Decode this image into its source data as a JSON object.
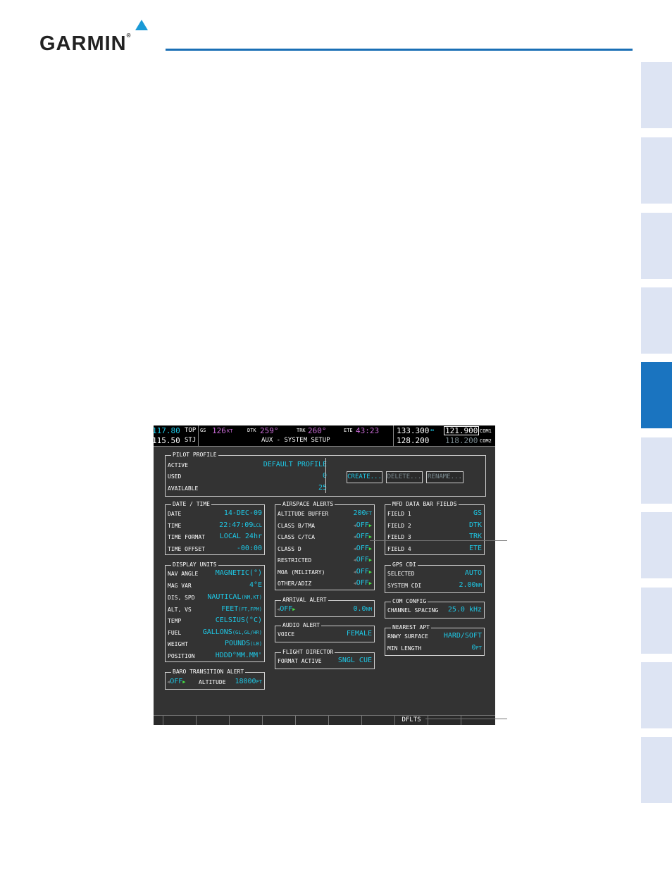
{
  "brand": {
    "name": "GARMIN",
    "reg": "®"
  },
  "screen": {
    "topbar": {
      "nav1_active": "117.80",
      "nav1_ident": "TOP",
      "nav2_active": "115.50",
      "nav2_ident": "STJ",
      "gs_label": "GS",
      "gs_value": "126",
      "gs_unit": "KT",
      "dtk_label": "DTK",
      "dtk_value": "259°",
      "trk_label": "TRK",
      "trk_value": "260°",
      "ete_label": "ETE",
      "ete_value": "43:23",
      "page_title": "AUX - SYSTEM SETUP",
      "com1_active": "121.900",
      "com1_standby": "133.300",
      "com1_label": "COM1",
      "com2_active": "118.200",
      "com2_standby": "128.200",
      "com2_label": "COM2",
      "swap_icon": "↔"
    },
    "pilot_profile": {
      "title": "PILOT PROFILE",
      "rows": [
        {
          "label": "ACTIVE",
          "value": "DEFAULT PROFILE"
        },
        {
          "label": "USED",
          "value": "0"
        },
        {
          "label": "AVAILABLE",
          "value": "25"
        }
      ],
      "buttons": {
        "create": "CREATE...",
        "delete": "DELETE...",
        "rename": "RENAME..."
      }
    },
    "date_time": {
      "title": "DATE / TIME",
      "rows": [
        {
          "label": "DATE",
          "value": "14-DEC-09"
        },
        {
          "label": "TIME",
          "value": "22:47:09",
          "unit": "LCL"
        },
        {
          "label": "TIME FORMAT",
          "value": "LOCAL 24hr"
        },
        {
          "label": "TIME OFFSET",
          "value": "-00:00"
        }
      ]
    },
    "display_units": {
      "title": "DISPLAY UNITS",
      "rows": [
        {
          "label": "NAV ANGLE",
          "value": "MAGNETIC(°)"
        },
        {
          "label": "MAG VAR",
          "value": "4°E"
        },
        {
          "label": "DIS, SPD",
          "value": "NAUTICAL",
          "unit": "(NM,KT)"
        },
        {
          "label": "ALT, VS",
          "value": "FEET",
          "unit": "(FT,FPM)"
        },
        {
          "label": "TEMP",
          "value": "CELSIUS(°C)"
        },
        {
          "label": "FUEL",
          "value": "GALLONS",
          "unit": "(GL,GL/HR)"
        },
        {
          "label": "WEIGHT",
          "value": "POUNDS",
          "unit": "(LB)"
        },
        {
          "label": "POSITION",
          "value": "HDDD°MM.MM'"
        }
      ]
    },
    "baro_transition": {
      "title": "BARO TRANSITION ALERT",
      "state": "OFF",
      "altitude_label": "ALTITUDE",
      "altitude_value": "18000",
      "altitude_unit": "FT"
    },
    "airspace_alerts": {
      "title": "AIRSPACE ALERTS",
      "altitude_buffer_label": "ALTITUDE BUFFER",
      "altitude_buffer_value": "200",
      "altitude_buffer_unit": "FT",
      "rows": [
        {
          "label": "CLASS B/TMA",
          "value": "OFF"
        },
        {
          "label": "CLASS C/TCA",
          "value": "OFF"
        },
        {
          "label": "CLASS D",
          "value": "OFF"
        },
        {
          "label": "RESTRICTED",
          "value": "OFF"
        },
        {
          "label": "MOA (MILITARY)",
          "value": "OFF"
        },
        {
          "label": "OTHER/ADIZ",
          "value": "OFF"
        }
      ]
    },
    "arrival_alert": {
      "title": "ARRIVAL ALERT",
      "state": "OFF",
      "value": "0.0",
      "unit": "NM"
    },
    "audio_alert": {
      "title": "AUDIO ALERT",
      "label": "VOICE",
      "value": "FEMALE"
    },
    "flight_director": {
      "title": "FLIGHT DIRECTOR",
      "label": "FORMAT ACTIVE",
      "value": "SNGL CUE"
    },
    "mfd_fields": {
      "title": "MFD DATA BAR FIELDS",
      "rows": [
        {
          "label": "FIELD 1",
          "value": "GS"
        },
        {
          "label": "FIELD 2",
          "value": "DTK"
        },
        {
          "label": "FIELD 3",
          "value": "TRK"
        },
        {
          "label": "FIELD 4",
          "value": "ETE"
        }
      ]
    },
    "gps_cdi": {
      "title": "GPS CDI",
      "rows": [
        {
          "label": "SELECTED",
          "value": "AUTO"
        },
        {
          "label": "SYSTEM CDI",
          "value": "2.00",
          "unit": "NM"
        }
      ]
    },
    "com_config": {
      "title": "COM CONFIG",
      "label": "CHANNEL SPACING",
      "value": "25.0 kHz"
    },
    "nearest_apt": {
      "title": "NEAREST APT",
      "rows": [
        {
          "label": "RNWY SURFACE",
          "value": "HARD/SOFT"
        },
        {
          "label": "MIN LENGTH",
          "value": "0",
          "unit": "FT"
        }
      ]
    },
    "softkey": {
      "dflts": "DFLTS"
    }
  },
  "colors": {
    "accent": "#1a74c0",
    "tab": "#dde4f3",
    "value_cyan": "#1ec8e6",
    "magenta": "#c96bd6",
    "arrow_green": "#44e044"
  }
}
